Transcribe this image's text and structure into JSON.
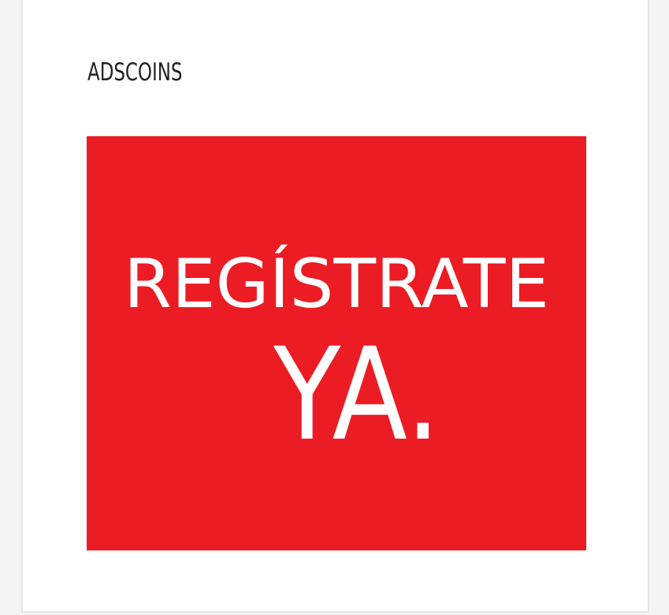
{
  "widget": {
    "title": "ADSCOINS"
  },
  "banner": {
    "line1": "REGÍSTRATE",
    "line2": "YA.",
    "background_color": "#ec1c24",
    "text_color": "#ffffff"
  }
}
